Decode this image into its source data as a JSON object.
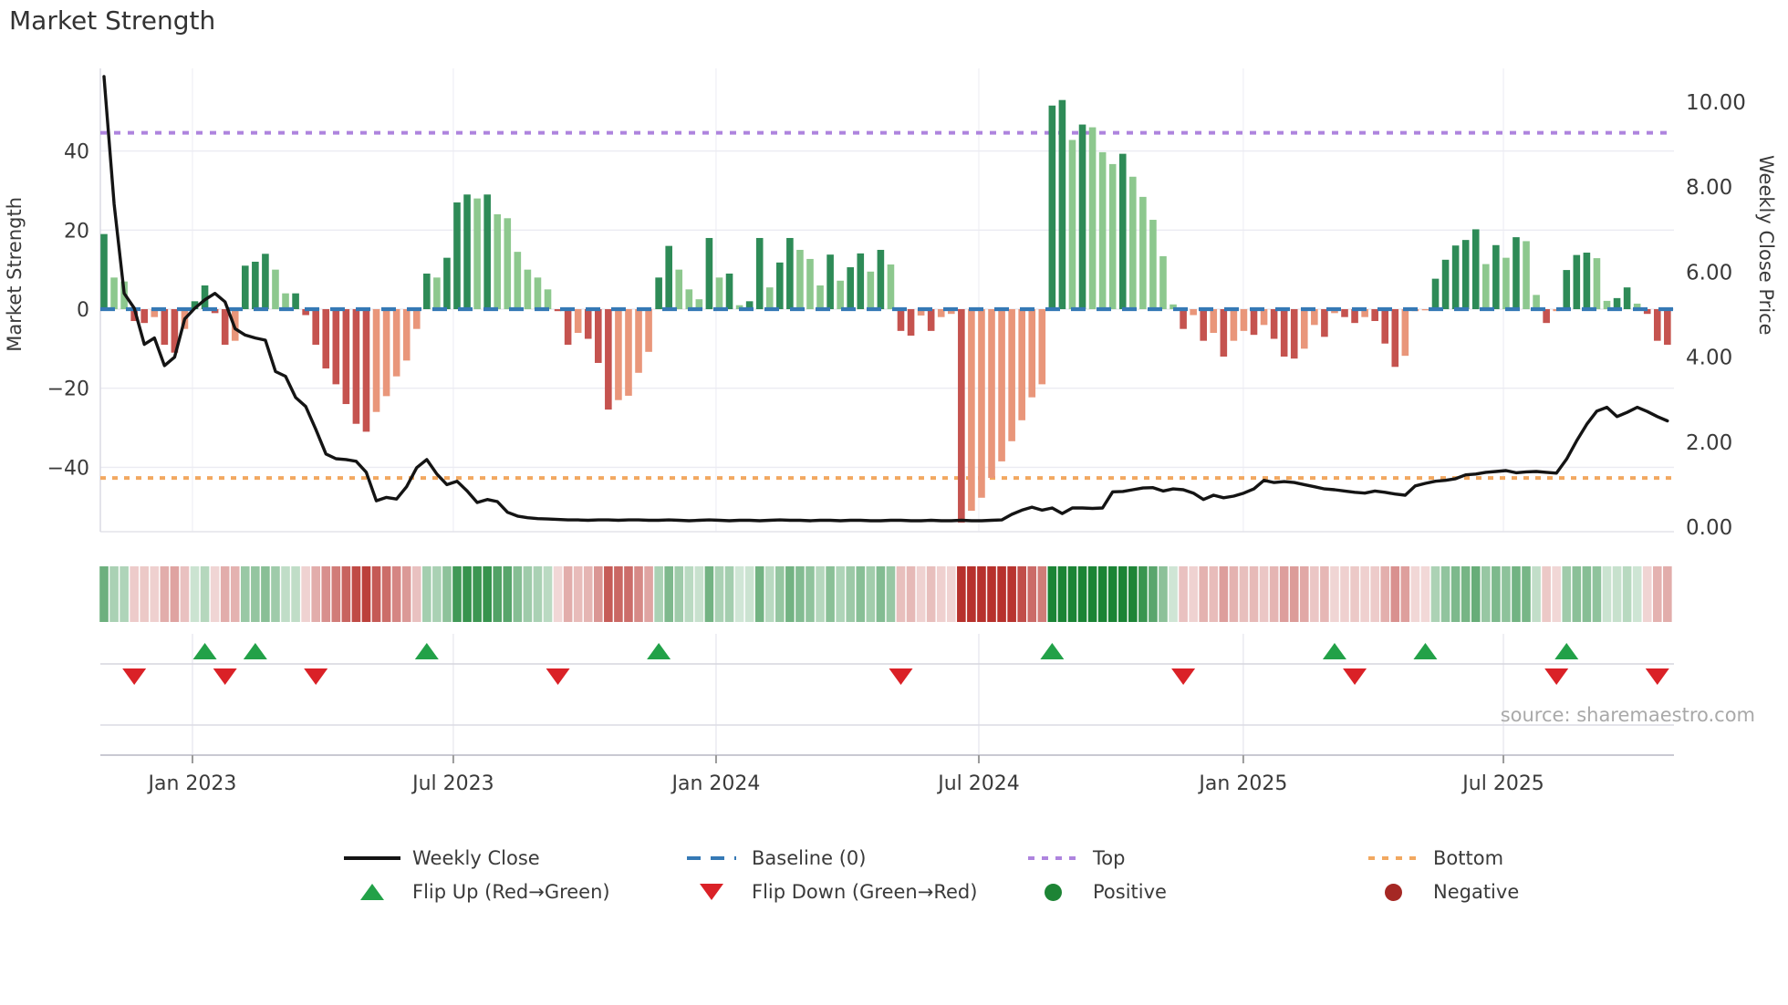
{
  "title": "Market Strength",
  "source": "source: sharemaestro.com",
  "axes": {
    "left": {
      "label": "Market Strength",
      "tick_labels": [
        "40",
        "20",
        "0",
        "−20",
        "−40"
      ],
      "tick_values": [
        40,
        20,
        0,
        -20,
        -40
      ]
    },
    "right": {
      "label": "Weekly Close Price",
      "tick_labels": [
        "10.00",
        "8.00",
        "6.00",
        "4.00",
        "2.00",
        "0.00"
      ],
      "tick_values": [
        10,
        8,
        6,
        4,
        2,
        0
      ]
    },
    "x": {
      "tick_labels": [
        "Jan 2023",
        "Jul 2023",
        "Jan 2024",
        "Jul 2024",
        "Jan 2025",
        "Jul 2025"
      ],
      "tick_weeks": [
        8.77,
        34.63,
        60.68,
        86.73,
        112.95,
        138.74
      ]
    }
  },
  "legend": {
    "items": [
      {
        "label": "Weekly Close",
        "swatch": "line-black"
      },
      {
        "label": "Baseline (0)",
        "swatch": "dash-blue"
      },
      {
        "label": "Top",
        "swatch": "dot-purple"
      },
      {
        "label": "Bottom",
        "swatch": "dot-orange"
      },
      {
        "label": "Flip Up (Red→Green)",
        "swatch": "triangle-up-green"
      },
      {
        "label": "Flip Down (Green→Red)",
        "swatch": "triangle-down-red"
      },
      {
        "label": "Positive",
        "swatch": "circle-green"
      },
      {
        "label": "Negative",
        "swatch": "circle-darkred"
      }
    ]
  },
  "colors": {
    "bar_pos_strong": "#2e8b57",
    "bar_pos_weak": "#8dc88e",
    "bar_neg_strong": "#c5534f",
    "bar_neg_weak": "#e9967a",
    "close_line": "#141414",
    "baseline": "#3579b5",
    "top_line": "#ae84de",
    "bottom_line": "#f2a860",
    "flip_up": "#22a148",
    "flip_down": "#da2127",
    "heat_green": "#1b8435",
    "heat_red": "#b7312c",
    "grid": "#ebebf2",
    "axis_text": "#3a3a3a"
  },
  "chart_data": {
    "type": "bar+line combo with heatmap strip and flip markers",
    "weeks": 156,
    "x_start_label": "Nov 2022",
    "baseline": 0,
    "top_line_value": 44.6,
    "bottom_line_value": -42.7,
    "left_ylim": [
      -56,
      61
    ],
    "right_ylim": [
      -0.1,
      10.8
    ],
    "grid": true,
    "bars": [
      19,
      8,
      7,
      -3,
      -3.5,
      -2,
      -9,
      -11,
      -5,
      2,
      6,
      -1,
      -9,
      -8,
      11,
      12,
      14,
      10,
      4,
      4,
      -1.5,
      -9,
      -15,
      -19,
      -24,
      -29,
      -31,
      -26,
      -22,
      -17,
      -13,
      -5,
      9,
      8,
      13,
      27,
      29,
      28,
      29,
      24,
      23,
      14.5,
      10,
      8,
      5,
      -0.5,
      -9,
      -6,
      -7.5,
      -13.6,
      -25.4,
      -23,
      -21.9,
      -16.1,
      -10.8,
      8,
      16,
      10,
      5,
      2.5,
      18,
      8,
      9,
      1,
      2,
      18,
      5.5,
      11.8,
      18,
      15,
      12.7,
      6,
      13.8,
      7.2,
      10.6,
      14.1,
      9.5,
      15,
      11.3,
      -5.5,
      -6.7,
      -1.6,
      -5.5,
      -2,
      -1.2,
      -54,
      -51,
      -47.7,
      -42.7,
      -38.5,
      -33.4,
      -28.1,
      -22.3,
      -19,
      51.5,
      52.9,
      42.8,
      46.7,
      46,
      39.7,
      36.7,
      39.3,
      33.5,
      28.4,
      22.6,
      13.4,
      1.2,
      -5,
      -1.5,
      -8,
      -6,
      -12,
      -8,
      -5.5,
      -6.5,
      -4,
      -7.5,
      -12,
      -12.5,
      -10,
      -4,
      -7,
      -1,
      -2,
      -3.5,
      -2,
      -3,
      -8.7,
      -14.6,
      -11.8,
      -0.5,
      -0.3,
      7.7,
      12.5,
      16.1,
      17.5,
      20.2,
      11.4,
      16.2,
      13,
      18.2,
      17.2,
      3.6,
      -3.5,
      -0.5,
      9.9,
      13.7,
      14.3,
      12.9,
      2.1,
      2.8,
      5.5,
      1.4,
      -1.2,
      -8,
      -9
    ],
    "close": [
      10.6,
      7.6,
      5.5,
      5.15,
      4.3,
      4.45,
      3.8,
      4.0,
      4.9,
      5.15,
      5.35,
      5.5,
      5.3,
      4.67,
      4.52,
      4.45,
      4.4,
      3.66,
      3.55,
      3.05,
      2.84,
      2.3,
      1.72,
      1.61,
      1.59,
      1.55,
      1.29,
      0.62,
      0.7,
      0.66,
      0.95,
      1.4,
      1.59,
      1.25,
      1.0,
      1.08,
      0.85,
      0.58,
      0.65,
      0.6,
      0.35,
      0.26,
      0.22,
      0.2,
      0.19,
      0.18,
      0.17,
      0.17,
      0.16,
      0.17,
      0.17,
      0.16,
      0.17,
      0.17,
      0.16,
      0.16,
      0.17,
      0.16,
      0.15,
      0.16,
      0.17,
      0.16,
      0.15,
      0.16,
      0.16,
      0.15,
      0.16,
      0.17,
      0.16,
      0.16,
      0.15,
      0.16,
      0.16,
      0.15,
      0.16,
      0.16,
      0.15,
      0.15,
      0.16,
      0.16,
      0.15,
      0.15,
      0.16,
      0.15,
      0.15,
      0.16,
      0.15,
      0.15,
      0.16,
      0.17,
      0.3,
      0.4,
      0.47,
      0.4,
      0.45,
      0.32,
      0.45,
      0.45,
      0.44,
      0.45,
      0.83,
      0.84,
      0.88,
      0.92,
      0.93,
      0.85,
      0.9,
      0.88,
      0.8,
      0.65,
      0.75,
      0.69,
      0.73,
      0.8,
      0.9,
      1.1,
      1.05,
      1.07,
      1.05,
      1.0,
      0.95,
      0.9,
      0.88,
      0.85,
      0.82,
      0.8,
      0.85,
      0.82,
      0.78,
      0.75,
      0.97,
      1.03,
      1.08,
      1.1,
      1.14,
      1.23,
      1.25,
      1.29,
      1.31,
      1.33,
      1.28,
      1.3,
      1.31,
      1.29,
      1.27,
      1.6,
      2.03,
      2.42,
      2.73,
      2.82,
      2.6,
      2.7,
      2.82,
      2.72,
      2.6,
      2.5
    ],
    "flip_up_weeks": [
      10,
      15,
      32,
      55,
      94,
      122,
      131,
      145
    ],
    "flip_down_weeks": [
      3,
      12,
      21,
      45,
      79,
      107,
      124,
      144,
      154
    ]
  }
}
